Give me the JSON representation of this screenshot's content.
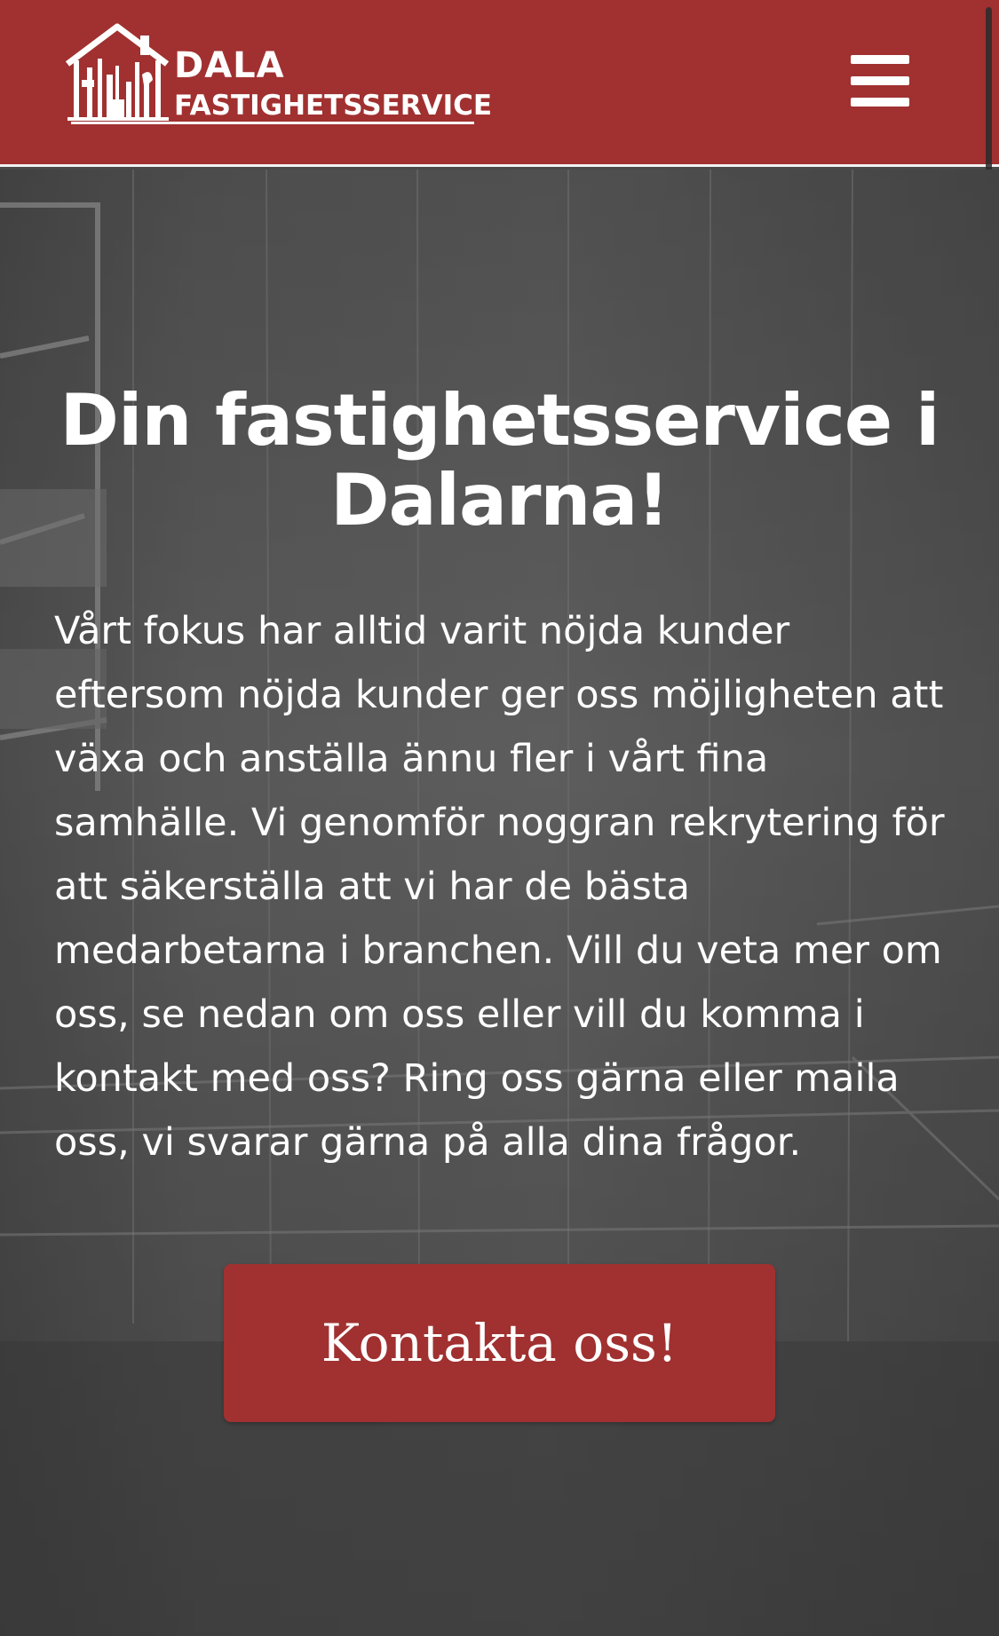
{
  "header": {
    "logo": {
      "line1": "DALA",
      "line2": "FASTIGHETSSERVICE",
      "icon": "house-tools-icon"
    },
    "menu_icon": "hamburger-menu-icon",
    "background_color": "#a03130"
  },
  "hero": {
    "title": "Din fastighetsservice i Dalarna!",
    "body": "Vårt fokus har alltid varit nöjda kunder eftersom nöjda kunder ger oss möjligheten att växa och anställa ännu fler i vårt fina samhälle. Vi genomför noggran rekrytering för att säkerställa att vi har de bästa medarbetarna i branchen. Vill du veta mer om oss, se nedan om oss eller vill du komma i kontakt med oss? Ring oss gärna eller maila oss, vi svarar gärna på alla dina frågor.",
    "cta_label": "Kontakta oss!",
    "cta_color": "#a03130"
  }
}
